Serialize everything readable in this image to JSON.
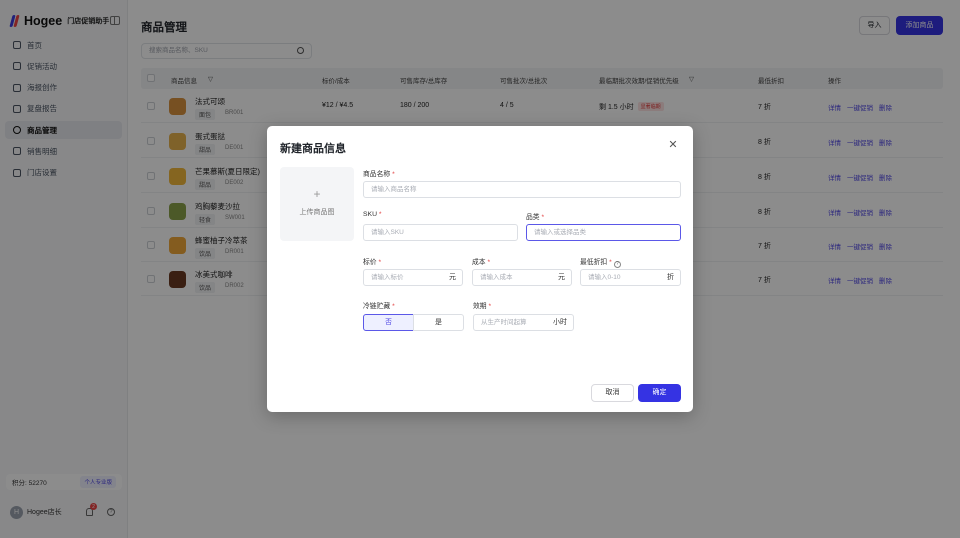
{
  "brand": {
    "name": "Hogee",
    "subtitle": "门店促销助手"
  },
  "sidebar": {
    "items": [
      {
        "label": "首页",
        "icon": "home-icon"
      },
      {
        "label": "促销活动",
        "icon": "gift-icon"
      },
      {
        "label": "海报创作",
        "icon": "image-icon"
      },
      {
        "label": "复盘报告",
        "icon": "report-icon"
      },
      {
        "label": "商品管理",
        "icon": "product-icon",
        "active": true
      },
      {
        "label": "销售明细",
        "icon": "list-icon"
      },
      {
        "label": "门店设置",
        "icon": "store-icon"
      }
    ],
    "points_label": "积分: 52270",
    "plan_badge": "个人专业版",
    "user_name": "Hogee店长",
    "avatar_letter": "H",
    "notification_count": "2"
  },
  "page": {
    "title": "商品管理",
    "import_label": "导入",
    "add_label": "添加商品",
    "search_placeholder": "搜索商品名称、SKU"
  },
  "table": {
    "columns": [
      "商品信息",
      "标价/成本",
      "可售库存/总库存",
      "可售批次/总批次",
      "最临期批次效期/促销优先级",
      "最低折扣",
      "操作"
    ],
    "rows": [
      {
        "name": "法式可颂",
        "category": "面包",
        "sku": "BR001",
        "price_cost": "¥12 / ¥4.5",
        "stock": "180 / 200",
        "batches": "4 / 5",
        "expiry": "剩 1.5 小时",
        "priority_badge": "显著临期",
        "discount": "7 折",
        "thumb": "#d9923f"
      },
      {
        "name": "蛋式蛋挞",
        "category": "甜品",
        "sku": "DE001",
        "discount": "8 折",
        "thumb": "#e8b34d"
      },
      {
        "name": "芒果慕斯(夏日限定)",
        "category": "甜品",
        "sku": "DE002",
        "discount": "8 折",
        "thumb": "#f2b93b"
      },
      {
        "name": "鸡胸藜麦沙拉",
        "category": "轻食",
        "sku": "SW001",
        "discount": "8 折",
        "thumb": "#8aa24a"
      },
      {
        "name": "蜂蜜柚子冷萃茶",
        "category": "饮品",
        "sku": "DR001",
        "discount": "7 折",
        "thumb": "#f0a83a"
      },
      {
        "name": "冰美式咖啡",
        "category": "饮品",
        "sku": "DR002",
        "discount": "7 折",
        "thumb": "#6b3a22"
      }
    ],
    "actions": [
      "详情",
      "一键促销",
      "删除"
    ]
  },
  "modal": {
    "title": "新建商品信息",
    "upload_label": "上传商品图",
    "fields": {
      "name": {
        "label": "商品名称",
        "placeholder": "请输入商品名称"
      },
      "sku": {
        "label": "SKU",
        "placeholder": "请输入SKU"
      },
      "category": {
        "label": "品类",
        "placeholder": "请输入或选择品类"
      },
      "price": {
        "label": "标价",
        "placeholder": "请输入标价",
        "unit": "元"
      },
      "cost": {
        "label": "成本",
        "placeholder": "请输入成本",
        "unit": "元"
      },
      "min_discount": {
        "label": "最低折扣",
        "placeholder": "请输入0-10",
        "unit": "折"
      },
      "cold_chain": {
        "label": "冷链贮藏",
        "options": [
          "否",
          "是"
        ],
        "selected": "否"
      },
      "shelf_life": {
        "label": "效期",
        "placeholder": "从生产时间起算",
        "unit": "小时"
      }
    },
    "cancel_label": "取消",
    "ok_label": "确定"
  },
  "colors": {
    "accent": "#3533e3",
    "danger": "#e23b3b"
  }
}
